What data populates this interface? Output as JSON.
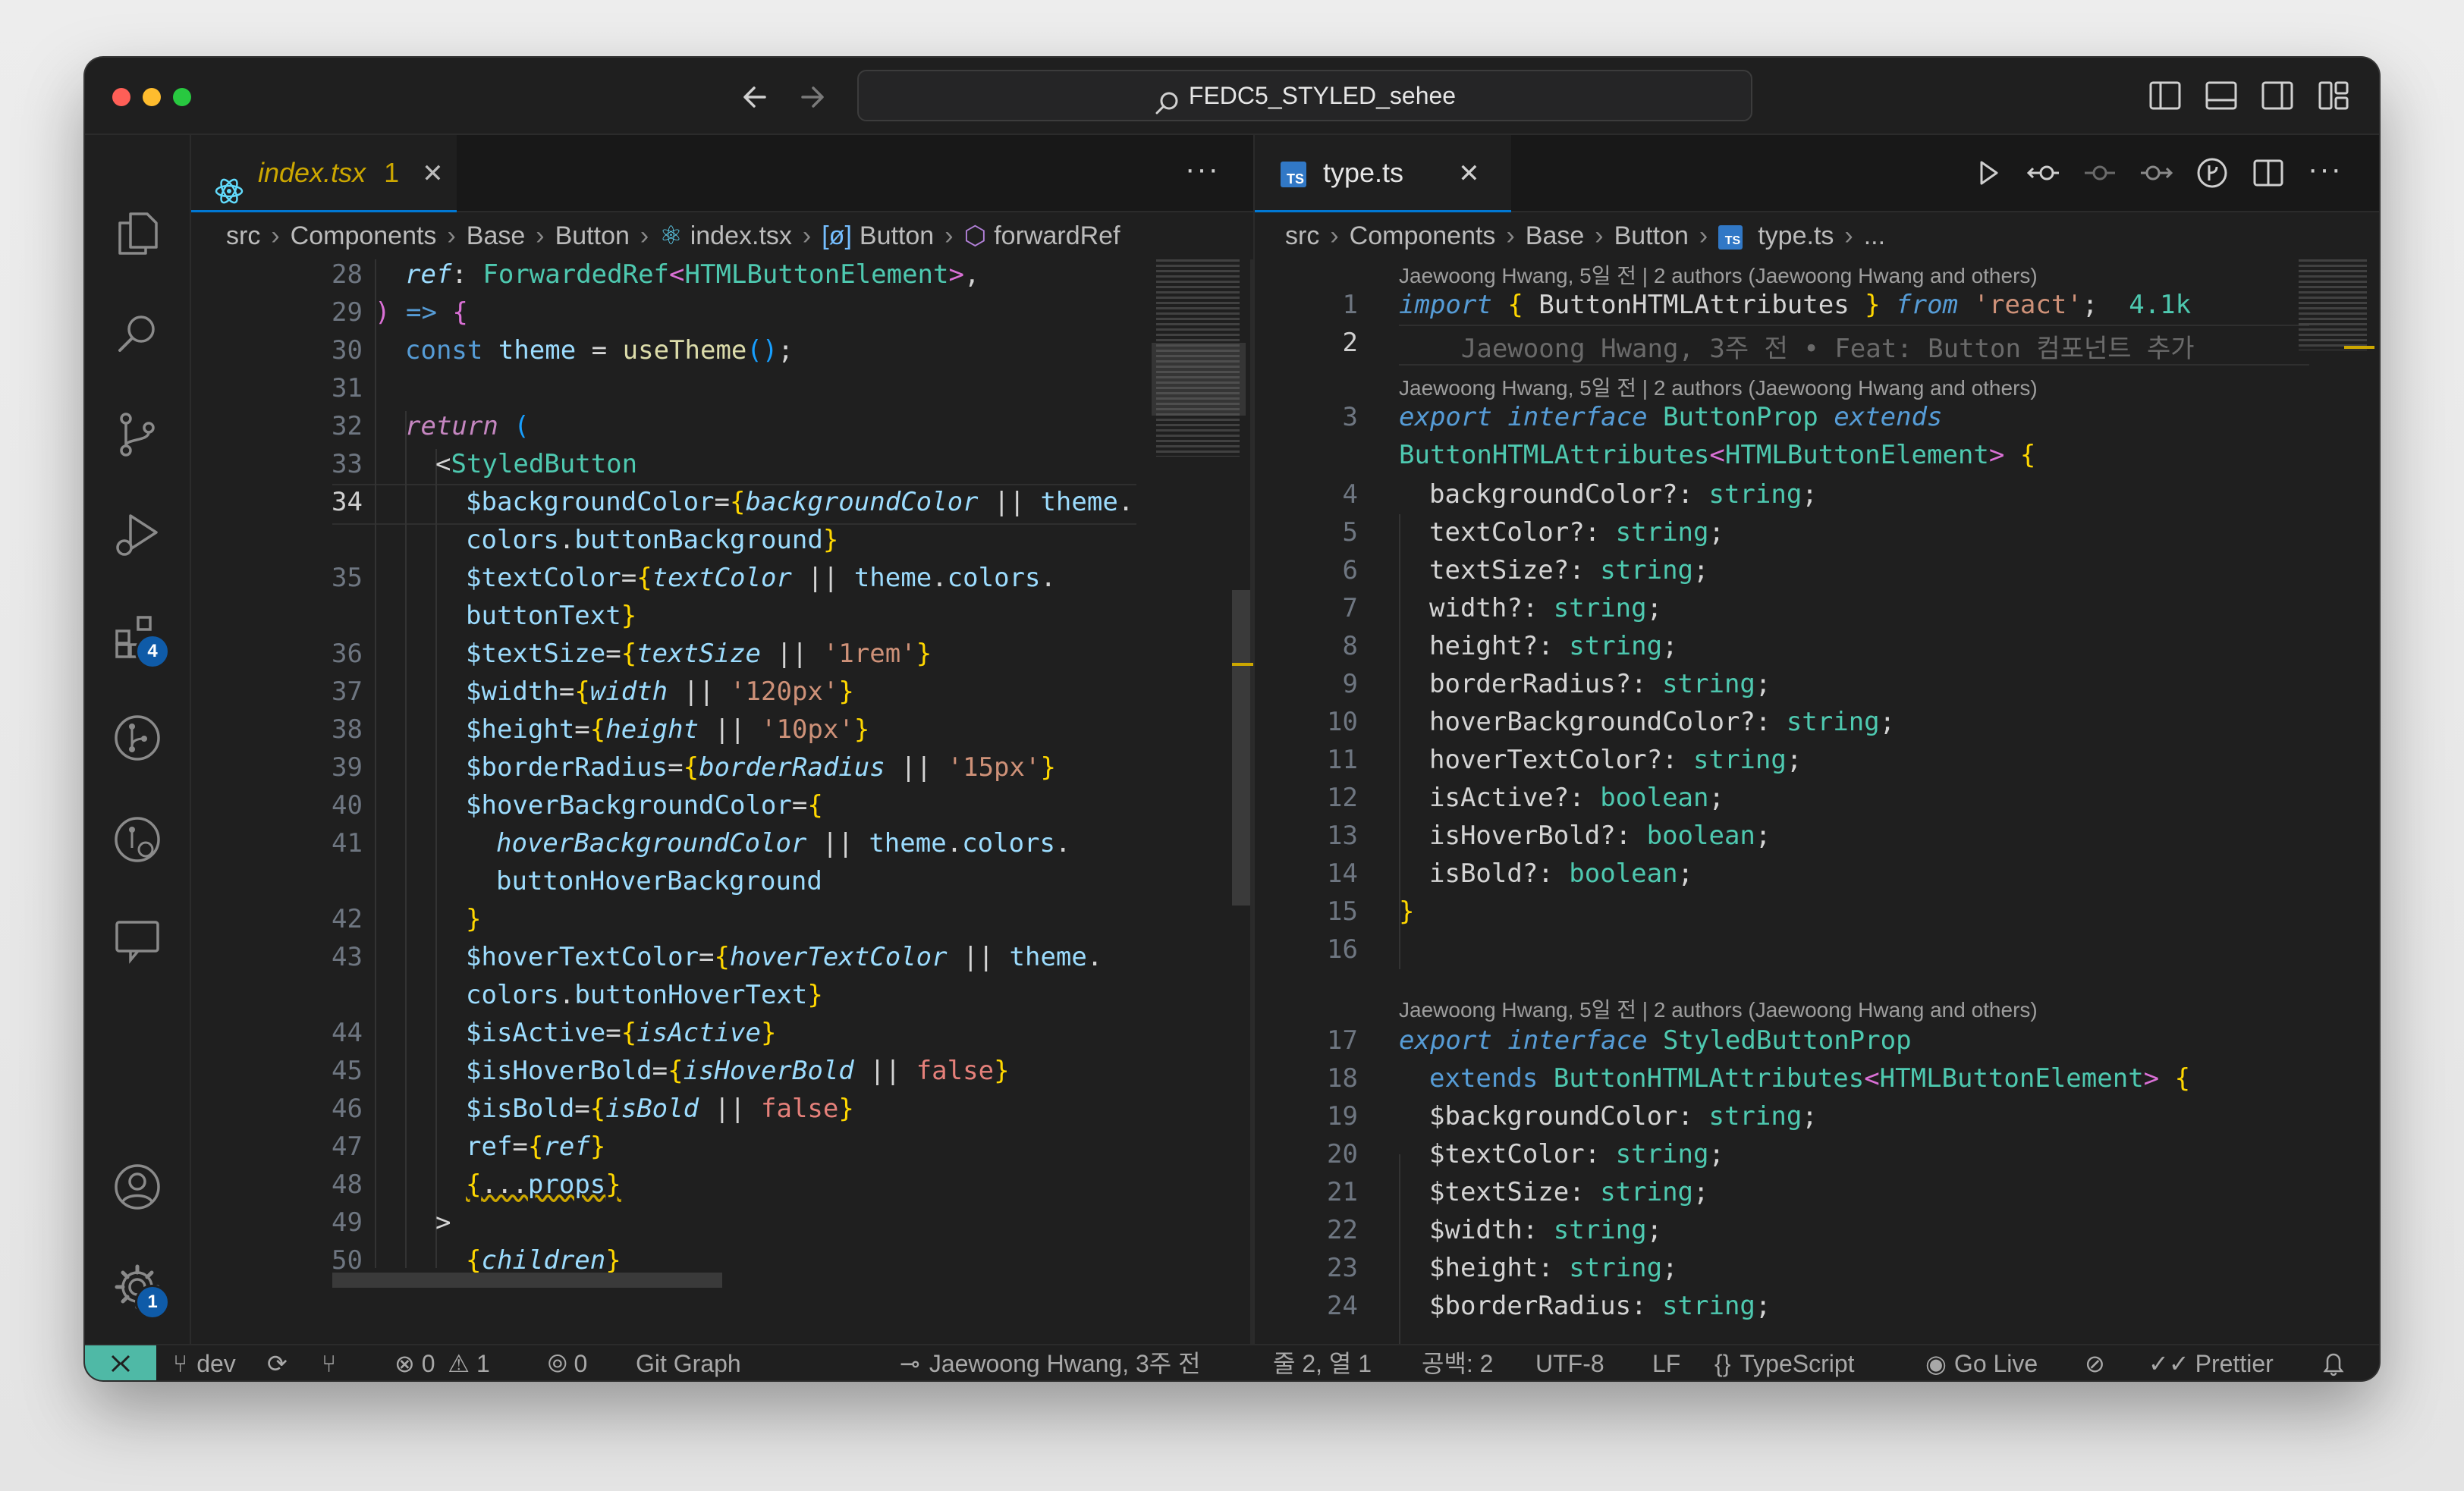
{
  "window": {
    "command_center": "FEDC5_STYLED_sehee",
    "colors": {
      "accent": "#0078d4",
      "remote": "#4fb9a6",
      "badge": "#0f5ba8",
      "ts_icon": "#3178c6"
    }
  },
  "activity_bar": {
    "extensions_badge": "4",
    "settings_badge": "1"
  },
  "left_editor": {
    "tab": {
      "label": "index.tsx",
      "problems": "1"
    },
    "breadcrumb": [
      "src",
      "Components",
      "Base",
      "Button",
      "index.tsx",
      "Button",
      "forwardRef"
    ],
    "line_numbers": [
      "28",
      "29",
      "30",
      "31",
      "32",
      "33",
      "34",
      "",
      "35",
      "",
      "36",
      "37",
      "38",
      "39",
      "40",
      "41",
      "",
      "42",
      "43",
      "",
      "44",
      "45",
      "46",
      "47",
      "48",
      "49",
      "50"
    ]
  },
  "right_editor": {
    "tab": {
      "label": "type.ts"
    },
    "breadcrumb": [
      "src",
      "Components",
      "Base",
      "Button",
      "type.ts",
      "..."
    ],
    "blame_1": "Jaewoong Hwang, 5일 전 | 2 authors (Jaewoong Hwang and others)",
    "blame_2": "Jaewoong Hwang, 5일 전 | 2 authors (Jaewoong Hwang and others)",
    "blame_3": "Jaewoong Hwang, 5일 전 | 2 authors (Jaewoong Hwang and others)",
    "inline_blame": "Jaewoong Hwang, 3주 전 • Feat: Button 컴포넌트 추가",
    "import_size": "4.1k",
    "line_numbers": [
      "1",
      "2",
      "3",
      "",
      "4",
      "5",
      "6",
      "7",
      "8",
      "9",
      "10",
      "11",
      "12",
      "13",
      "14",
      "15",
      "16",
      "17",
      "18",
      "19",
      "20",
      "21",
      "22",
      "23",
      "24"
    ]
  },
  "status_bar": {
    "branch": "dev",
    "errors": "0",
    "warnings": "1",
    "ports": "0",
    "git_graph": "Git Graph",
    "blame": "Jaewoong Hwang, 3주 전",
    "cursor": "줄 2, 열 1",
    "spaces": "공백: 2",
    "encoding": "UTF-8",
    "eol": "LF",
    "language": "TypeScript",
    "go_live": "Go Live",
    "prettier": "Prettier"
  }
}
